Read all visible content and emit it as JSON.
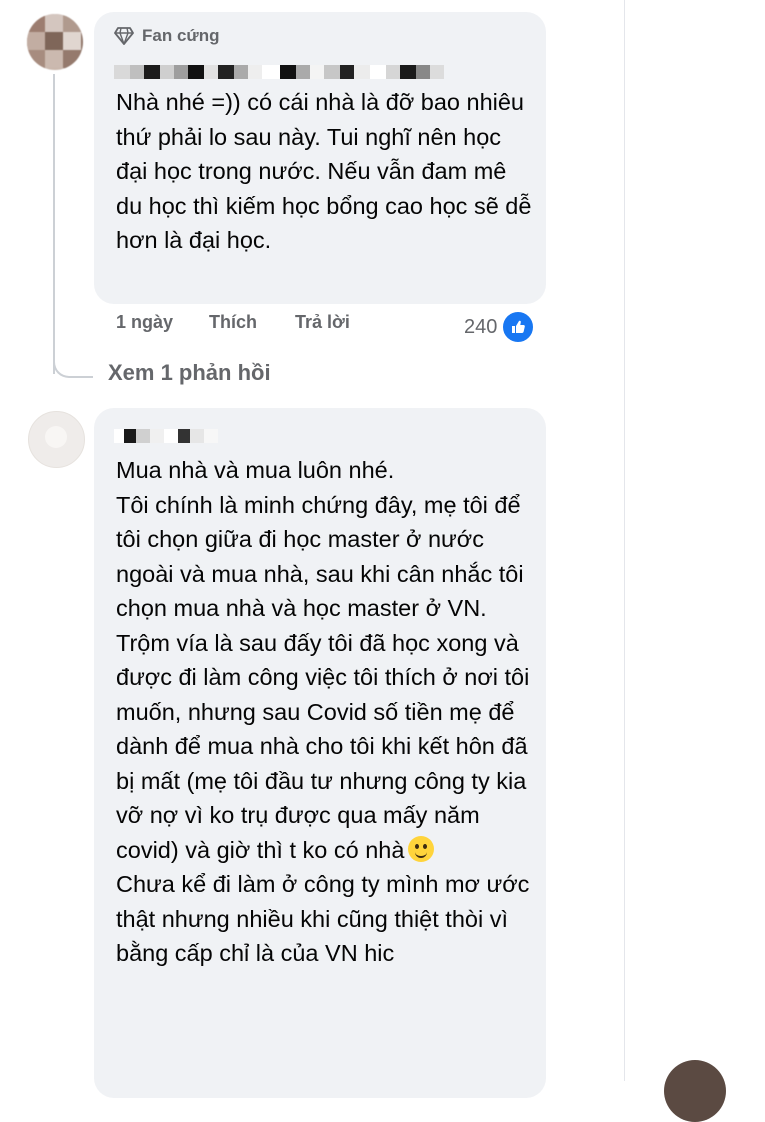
{
  "comment1": {
    "badge": "Fan cứng",
    "text": "Nhà nhé =)) có cái nhà là đỡ bao nhiêu thứ phải lo sau này. Tui nghĩ nên học đại học trong nước. Nếu vẫn đam mê du học thì kiếm học bổng cao học sẽ dễ hơn là đại học.",
    "time": "1 ngày",
    "like_label": "Thích",
    "reply_label": "Trả lời",
    "reaction_count": "240",
    "view_replies": "Xem 1 phản hồi"
  },
  "comment2": {
    "text_part1": "Mua nhà và mua luôn nhé.\nTôi chính là minh chứng đây, mẹ tôi để tôi chọn giữa đi học master ở nước ngoài và mua nhà, sau khi cân nhắc tôi chọn mua nhà và học master ở VN. Trộm vía là sau đấy tôi đã học xong và được đi làm công việc tôi thích ở nơi tôi muốn, nhưng sau Covid số tiền mẹ để dành để mua nhà cho tôi khi kết hôn đã bị mất (mẹ tôi đầu tư nhưng công ty kia vỡ nợ vì ko trụ được qua mấy năm covid) và giờ thì t ko có nhà",
    "text_part2": "\nChưa kể đi làm ở công ty mình mơ ước thật nhưng nhiều khi cũng thiệt thòi vì bằng cấp chỉ là của VN hic"
  },
  "colors": {
    "bubble": "#f0f2f5",
    "meta_text": "#65676b",
    "like_blue": "#1877f2"
  },
  "icons": [
    "diamond-icon",
    "thumbs-up-icon",
    "smile-emoji"
  ]
}
